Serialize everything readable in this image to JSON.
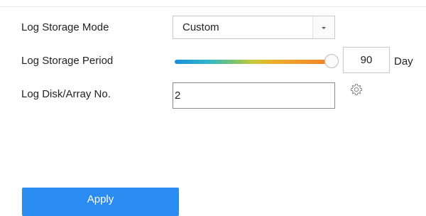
{
  "form": {
    "log_storage_mode": {
      "label": "Log Storage Mode",
      "selected": "Custom"
    },
    "log_storage_period": {
      "label": "Log Storage Period",
      "slider_fraction": 0.98,
      "value": "90",
      "unit": "Day"
    },
    "log_disk": {
      "label": "Log Disk/Array No.",
      "value": "2"
    }
  },
  "actions": {
    "apply_label": "Apply"
  },
  "icons": {
    "dropdown": "chevron-down-icon",
    "settings": "gear-icon"
  },
  "colors": {
    "primary": "#2a8cf0",
    "slider_start": "#1a8fd8",
    "slider_end": "#f57e20"
  }
}
